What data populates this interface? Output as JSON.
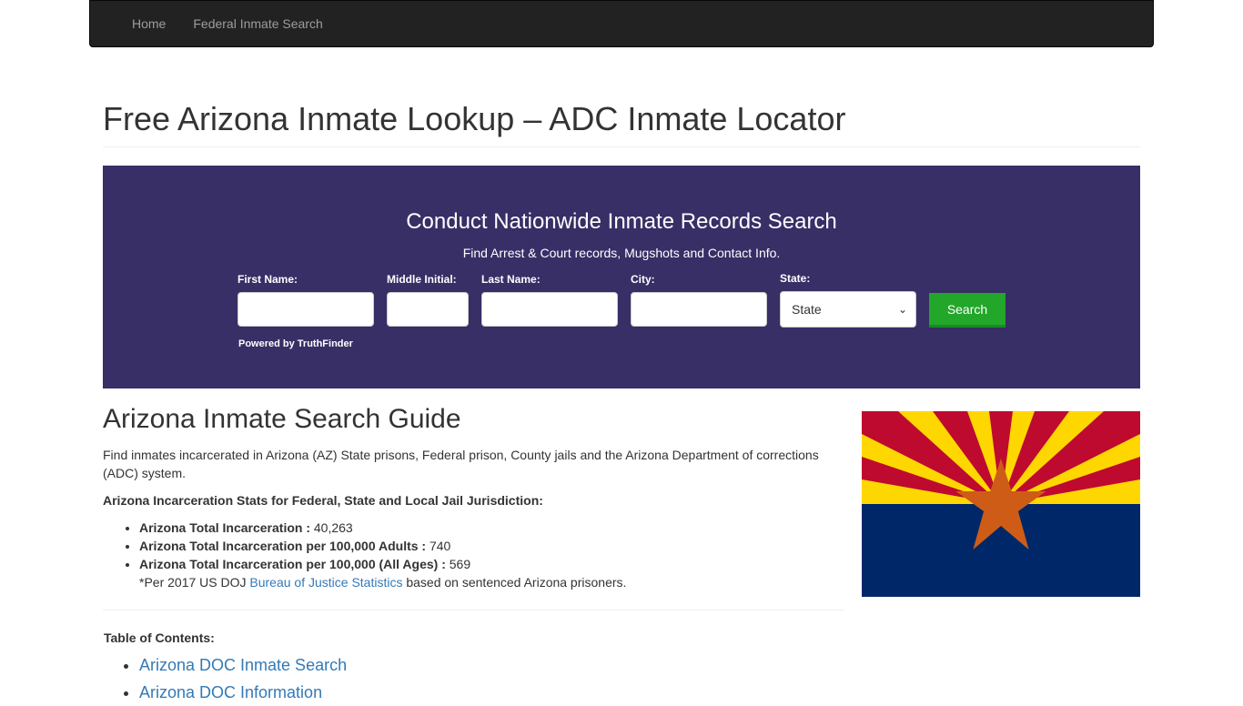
{
  "nav": {
    "items": [
      {
        "label": "Home"
      },
      {
        "label": "Federal Inmate Search"
      }
    ]
  },
  "page": {
    "title": "Free Arizona Inmate Lookup – ADC Inmate Locator"
  },
  "search": {
    "title": "Conduct Nationwide Inmate Records Search",
    "subtitle": "Find Arrest & Court records, Mugshots and Contact Info.",
    "fields": {
      "first_name": {
        "label": "First Name:",
        "value": ""
      },
      "middle_initial": {
        "label": "Middle Initial:",
        "value": ""
      },
      "last_name": {
        "label": "Last Name:",
        "value": ""
      },
      "city": {
        "label": "City:",
        "value": ""
      },
      "state": {
        "label": "State:",
        "selected": "State"
      }
    },
    "button_label": "Search",
    "powered_by": "Powered by TruthFinder",
    "colors": {
      "background": "#372f66",
      "button": "#22a72a"
    }
  },
  "guide": {
    "title": "Arizona Inmate Search Guide",
    "intro": "Find inmates incarcerated in Arizona (AZ) State prisons, Federal prison, County jails and the Arizona Department of corrections (ADC) system.",
    "stats_heading": "Arizona Incarceration Stats for Federal, State and Local Jail Jurisdiction:",
    "stats": [
      {
        "label": "Arizona Total Incarceration  :",
        "value": " 40,263"
      },
      {
        "label": "Arizona Total Incarceration per 100,000 Adults :",
        "value": " 740"
      },
      {
        "label": "Arizona Total Incarceration per 100,000 (All Ages) :",
        "value": " 569"
      }
    ],
    "note_prefix": "*Per 2017 US DOJ ",
    "note_link": "Bureau of Justice Statistics",
    "note_suffix": " based on sentenced Arizona prisoners."
  },
  "toc": {
    "heading": "Table of Contents:",
    "items": [
      {
        "label": "Arizona DOC Inmate Search"
      },
      {
        "label": "Arizona DOC Information"
      }
    ]
  },
  "flag": {
    "name": "Arizona state flag",
    "colors": {
      "red": "#bf0a30",
      "yellow": "#fed700",
      "blue": "#002868",
      "star": "#ce5c17"
    }
  }
}
